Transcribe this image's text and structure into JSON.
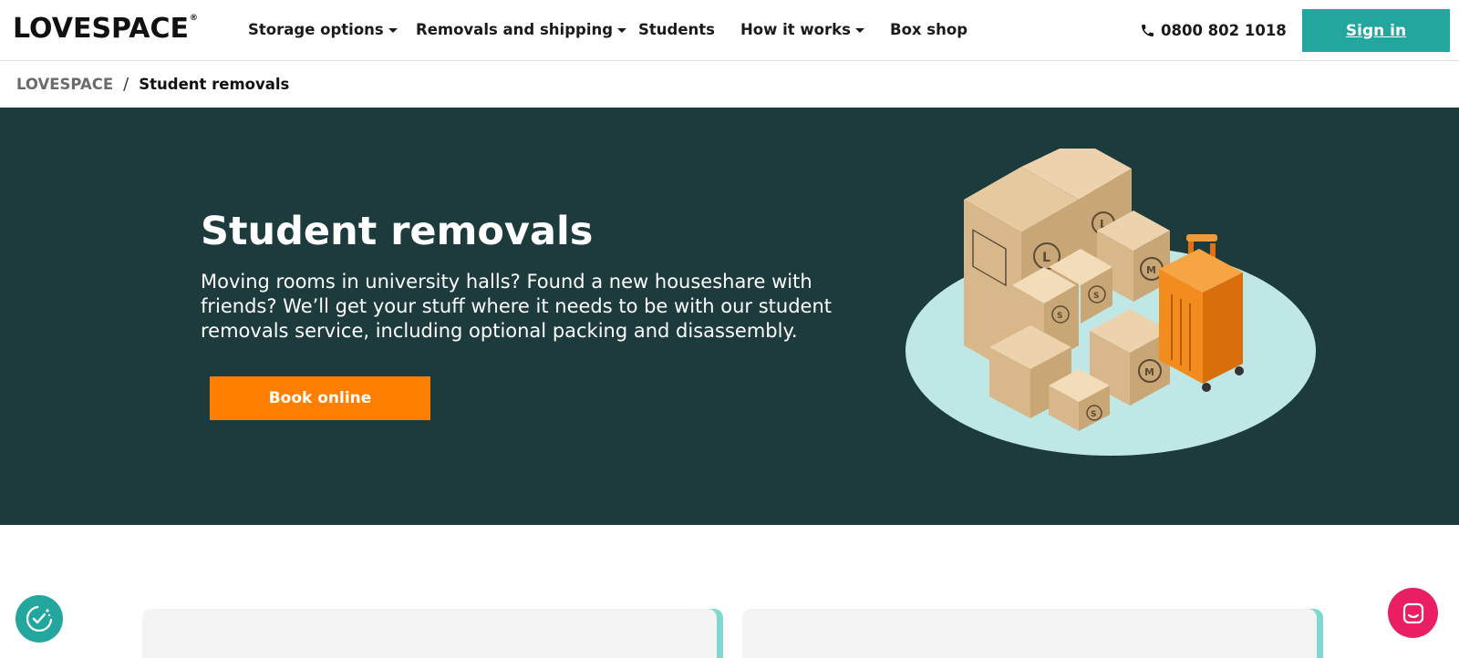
{
  "header": {
    "logo_text": "LOVESPACE",
    "logo_mark": "®",
    "nav": [
      {
        "label": "Storage options",
        "has_dropdown": true
      },
      {
        "label": "Removals and shipping",
        "has_dropdown": true
      },
      {
        "label": "Students",
        "has_dropdown": false
      },
      {
        "label": "How it works",
        "has_dropdown": true
      },
      {
        "label": "Box shop",
        "has_dropdown": false
      }
    ],
    "phone": "0800 802 1018",
    "signin_label": "Sign in"
  },
  "breadcrumb": {
    "root": "LOVESPACE",
    "separator": "/",
    "current": "Student removals"
  },
  "hero": {
    "title": "Student removals",
    "description": "Moving rooms in university halls? Found a new houseshare with friends? We’ll get your stuff where it needs to be with our student removals service, including optional packing and disassembly.",
    "cta_label": "Book online",
    "illustration": "boxes-and-suitcase-illustration"
  },
  "colors": {
    "hero_bg": "#1d3b3c",
    "accent_teal": "#22a69d",
    "cta_orange": "#ff7f00",
    "chat_pink": "#ea1f63",
    "card_shadow": "#7fd8d2"
  },
  "floating": {
    "consent_icon": "cookie-consent-icon",
    "chat_icon": "chat-icon"
  }
}
